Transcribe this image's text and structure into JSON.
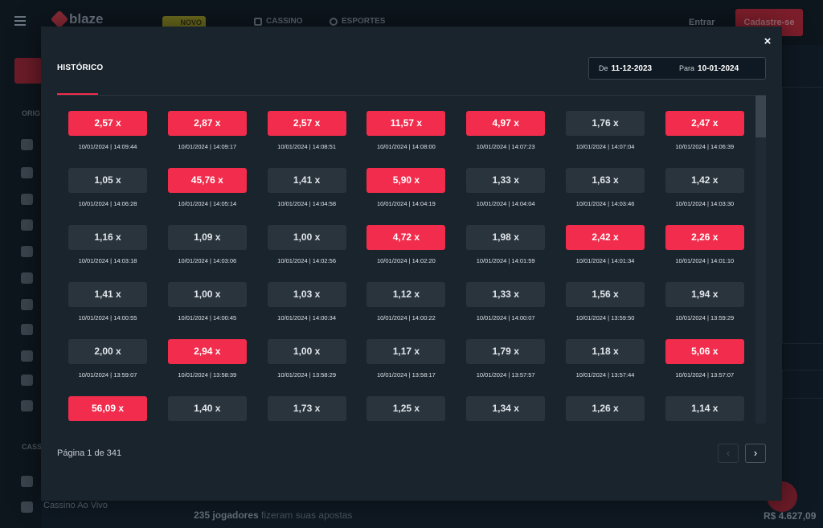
{
  "app": {
    "logo_text": "blaze",
    "novo_label": "NOVO",
    "nav": [
      {
        "label": "CASSINO"
      },
      {
        "label": "ESPORTES"
      }
    ],
    "entrar_label": "Entrar",
    "cadastre_label": "Cadastre-se",
    "sidebar_labels": [
      "ORIG",
      "CASS"
    ],
    "casino_vivo_label": "Cassino Ao Vivo",
    "players_count": "235 jogadores",
    "players_text": " fizeram suas apostas",
    "balance": "R$ 4.627,09"
  },
  "modal": {
    "title": "HISTÓRICO",
    "close_label": "×",
    "date_from_label": "De",
    "date_from": "11-12-2023",
    "date_to_label": "Para",
    "date_to": "10-01-2024",
    "pagination_text": "Página 1 de 341",
    "prev_label": "‹",
    "next_label": "›",
    "colors": {
      "red": "#f12c4c",
      "gray": "#2a343d",
      "accent": "#f12c4c"
    },
    "entries": [
      {
        "value": "2,57 x",
        "time": "10/01/2024 | 14:09:44",
        "color": "red"
      },
      {
        "value": "2,87 x",
        "time": "10/01/2024 | 14:09:17",
        "color": "red"
      },
      {
        "value": "2,57 x",
        "time": "10/01/2024 | 14:08:51",
        "color": "red"
      },
      {
        "value": "11,57 x",
        "time": "10/01/2024 | 14:08:00",
        "color": "red"
      },
      {
        "value": "4,97 x",
        "time": "10/01/2024 | 14:07:23",
        "color": "red"
      },
      {
        "value": "1,76 x",
        "time": "10/01/2024 | 14:07:04",
        "color": "gray"
      },
      {
        "value": "2,47 x",
        "time": "10/01/2024 | 14:06:39",
        "color": "red"
      },
      {
        "value": "1,05 x",
        "time": "10/01/2024 | 14:06:28",
        "color": "gray"
      },
      {
        "value": "45,76 x",
        "time": "10/01/2024 | 14:05:14",
        "color": "red"
      },
      {
        "value": "1,41 x",
        "time": "10/01/2024 | 14:04:58",
        "color": "gray"
      },
      {
        "value": "5,90 x",
        "time": "10/01/2024 | 14:04:19",
        "color": "red"
      },
      {
        "value": "1,33 x",
        "time": "10/01/2024 | 14:04:04",
        "color": "gray"
      },
      {
        "value": "1,63 x",
        "time": "10/01/2024 | 14:03:46",
        "color": "gray"
      },
      {
        "value": "1,42 x",
        "time": "10/01/2024 | 14:03:30",
        "color": "gray"
      },
      {
        "value": "1,16 x",
        "time": "10/01/2024 | 14:03:18",
        "color": "gray"
      },
      {
        "value": "1,09 x",
        "time": "10/01/2024 | 14:03:06",
        "color": "gray"
      },
      {
        "value": "1,00 x",
        "time": "10/01/2024 | 14:02:56",
        "color": "gray"
      },
      {
        "value": "4,72 x",
        "time": "10/01/2024 | 14:02:20",
        "color": "red"
      },
      {
        "value": "1,98 x",
        "time": "10/01/2024 | 14:01:59",
        "color": "gray"
      },
      {
        "value": "2,42 x",
        "time": "10/01/2024 | 14:01:34",
        "color": "red"
      },
      {
        "value": "2,26 x",
        "time": "10/01/2024 | 14:01:10",
        "color": "red"
      },
      {
        "value": "1,41 x",
        "time": "10/01/2024 | 14:00:55",
        "color": "gray"
      },
      {
        "value": "1,00 x",
        "time": "10/01/2024 | 14:00:45",
        "color": "gray"
      },
      {
        "value": "1,03 x",
        "time": "10/01/2024 | 14:00:34",
        "color": "gray"
      },
      {
        "value": "1,12 x",
        "time": "10/01/2024 | 14:00:22",
        "color": "gray"
      },
      {
        "value": "1,33 x",
        "time": "10/01/2024 | 14:00:07",
        "color": "gray"
      },
      {
        "value": "1,56 x",
        "time": "10/01/2024 | 13:59:50",
        "color": "gray"
      },
      {
        "value": "1,94 x",
        "time": "10/01/2024 | 13:59:29",
        "color": "gray"
      },
      {
        "value": "2,00 x",
        "time": "10/01/2024 | 13:59:07",
        "color": "gray"
      },
      {
        "value": "2,94 x",
        "time": "10/01/2024 | 13:58:39",
        "color": "red"
      },
      {
        "value": "1,00 x",
        "time": "10/01/2024 | 13:58:29",
        "color": "gray"
      },
      {
        "value": "1,17 x",
        "time": "10/01/2024 | 13:58:17",
        "color": "gray"
      },
      {
        "value": "1,79 x",
        "time": "10/01/2024 | 13:57:57",
        "color": "gray"
      },
      {
        "value": "1,18 x",
        "time": "10/01/2024 | 13:57:44",
        "color": "gray"
      },
      {
        "value": "5,06 x",
        "time": "10/01/2024 | 13:57:07",
        "color": "red"
      },
      {
        "value": "56,09 x",
        "time": "",
        "color": "red"
      },
      {
        "value": "1,40 x",
        "time": "",
        "color": "gray"
      },
      {
        "value": "1,73 x",
        "time": "",
        "color": "gray"
      },
      {
        "value": "1,25 x",
        "time": "",
        "color": "gray"
      },
      {
        "value": "1,34 x",
        "time": "",
        "color": "gray"
      },
      {
        "value": "1,26 x",
        "time": "",
        "color": "gray"
      },
      {
        "value": "1,14 x",
        "time": "",
        "color": "gray"
      }
    ]
  }
}
